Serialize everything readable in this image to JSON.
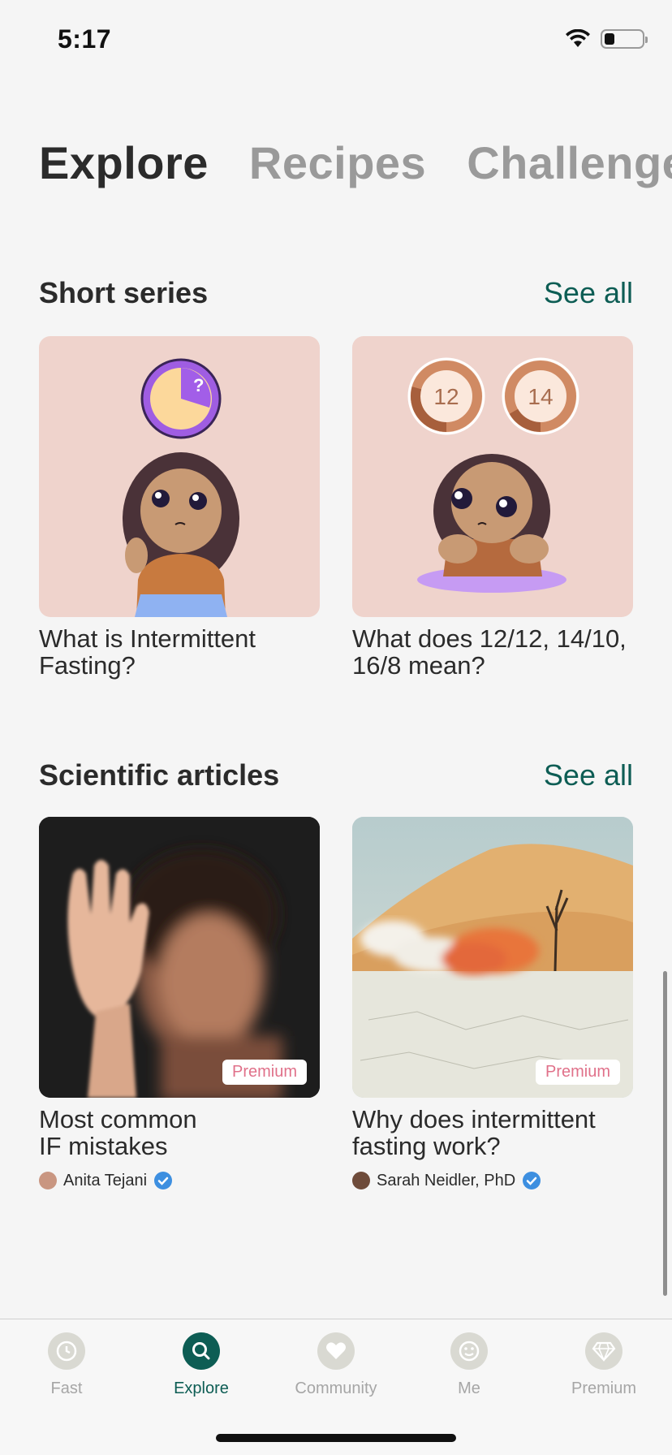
{
  "status": {
    "time": "5:17"
  },
  "tabs": [
    {
      "label": "Explore",
      "active": true
    },
    {
      "label": "Recipes",
      "active": false
    },
    {
      "label": "Challenges",
      "active": false
    }
  ],
  "short_series": {
    "title": "Short series",
    "see_all": "See all",
    "cards": [
      {
        "title_line1": "What is Intermittent",
        "title_line2": "Fasting?"
      },
      {
        "title_line1": "What does 12/12, 14/10,",
        "title_line2": "16/8 mean?",
        "badge_a": "12",
        "badge_b": "14"
      }
    ],
    "question_mark": "?"
  },
  "scientific_articles": {
    "title": "Scientific articles",
    "see_all": "See all",
    "cards": [
      {
        "title_line1": "Most common",
        "title_line2": "IF mistakes",
        "badge": "Premium",
        "author": "Anita Tejani"
      },
      {
        "title_line1": "Why does intermittent",
        "title_line2": "fasting work?",
        "badge": "Premium",
        "author": "Sarah Neidler, PhD"
      }
    ]
  },
  "nav": {
    "items": [
      {
        "label": "Fast",
        "icon": "clock-icon"
      },
      {
        "label": "Explore",
        "icon": "search-icon",
        "active": true
      },
      {
        "label": "Community",
        "icon": "heart-icon"
      },
      {
        "label": "Me",
        "icon": "smiley-icon"
      },
      {
        "label": "Premium",
        "icon": "diamond-icon"
      }
    ]
  },
  "colors": {
    "accent": "#0d5d54",
    "premium": "#e0718a",
    "card_bg": "#efd3cc"
  }
}
